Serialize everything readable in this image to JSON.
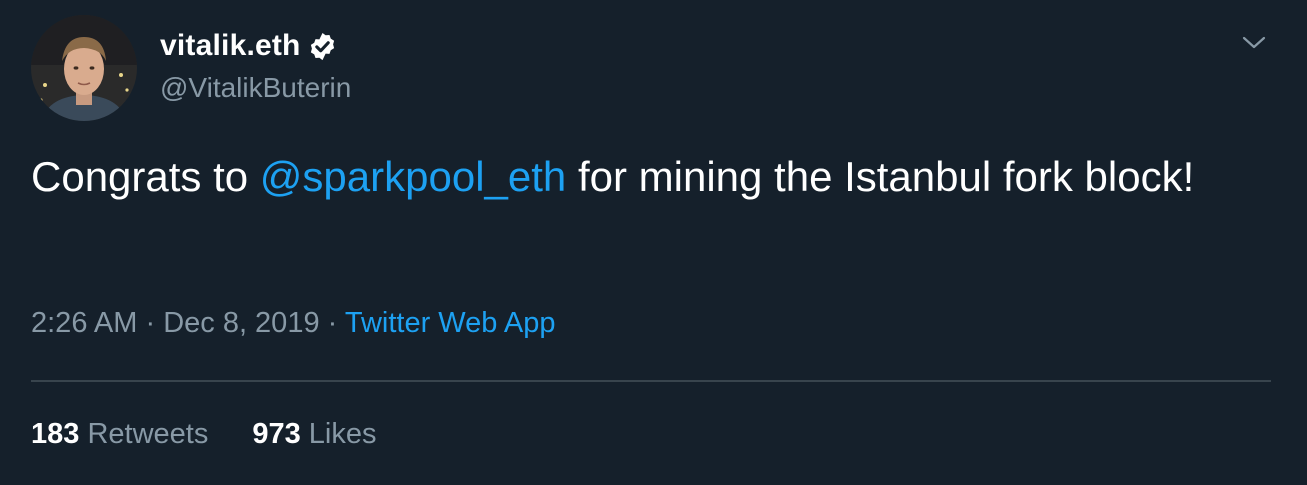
{
  "user": {
    "display_name": "vitalik.eth",
    "handle": "@VitalikButerin",
    "verified": true,
    "avatar_icon": "profile-photo"
  },
  "tweet": {
    "text_before": "Congrats to ",
    "mention": "@sparkpool_eth",
    "text_after": " for mining the Istanbul fork block!"
  },
  "meta": {
    "time": "2:26 AM",
    "separator1": " · ",
    "date": "Dec 8, 2019",
    "separator2": " · ",
    "source": "Twitter Web App"
  },
  "stats": {
    "retweets_count": "183",
    "retweets_label": "Retweets",
    "likes_count": "973",
    "likes_label": "Likes"
  },
  "icons": {
    "more": "chevron-down-icon",
    "verified": "verified-badge-icon"
  },
  "colors": {
    "background": "#15202b",
    "accent": "#1da1f2",
    "secondary_text": "#8899a6",
    "divider": "#38444d"
  }
}
